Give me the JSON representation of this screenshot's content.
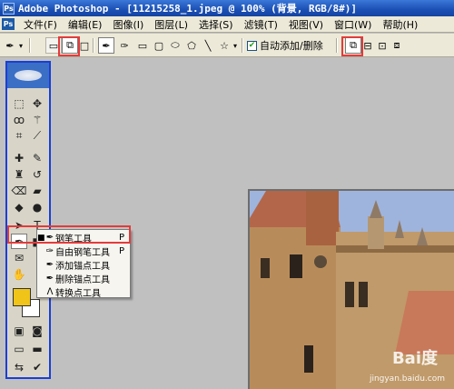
{
  "titlebar": {
    "title": "Adobe Photoshop - [11215258_1.jpeg @ 100% (背景, RGB/8#)]",
    "icon_letters": "Ps"
  },
  "menubar": {
    "logo": "Ps",
    "items": [
      "文件(F)",
      "编辑(E)",
      "图像(I)",
      "图层(L)",
      "选择(S)",
      "滤镜(T)",
      "视图(V)",
      "窗口(W)",
      "帮助(H)"
    ]
  },
  "options": {
    "auto_add_delete_label": "自动添加/删除",
    "auto_add_delete_checked": true
  },
  "flyout": {
    "items": [
      {
        "label": "钢笔工具",
        "key": "P",
        "active": true
      },
      {
        "label": "自由钢笔工具",
        "key": "P",
        "active": false
      },
      {
        "label": "添加锚点工具",
        "key": "",
        "active": false
      },
      {
        "label": "删除锚点工具",
        "key": "",
        "active": false
      },
      {
        "label": "转换点工具",
        "key": "",
        "active": false
      }
    ]
  },
  "swatches": {
    "foreground": "#f0c419",
    "background": "#ffffff"
  },
  "canvas": {
    "watermark": "Bai度",
    "watermark_url": "jingyan.baidu.com"
  },
  "colors": {
    "title_bar": "#1b4fb3",
    "toolbox_border": "#1a3ed6",
    "highlight_box": "#e33b3b"
  }
}
